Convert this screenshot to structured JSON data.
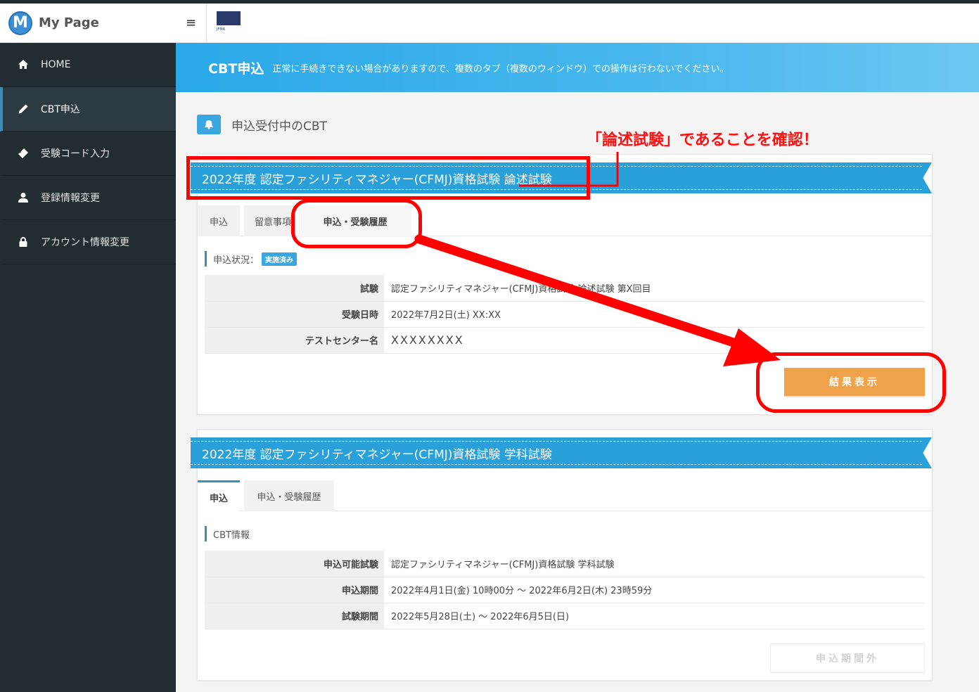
{
  "sidebar": {
    "brand": "My Page",
    "brand_initial": "M",
    "items": [
      {
        "label": "HOME"
      },
      {
        "label": "CBT申込"
      },
      {
        "label": "受験コード入力"
      },
      {
        "label": "登録情報変更"
      },
      {
        "label": "アカウント情報変更"
      }
    ]
  },
  "header": {
    "menu_icon": "≡",
    "org_logo_text": "JFMA"
  },
  "banner": {
    "title": "CBT申込",
    "message": "正常に手続きできない場合がありますので、複数のタブ（複数のウィンドウ）での操作は行わないでください。"
  },
  "section": {
    "title": "申込受付中のCBT"
  },
  "annotation": {
    "text": "「論述試験」であることを確認！"
  },
  "cards": [
    {
      "title": "2022年度 認定ファシリティマネジャー(CFMJ)資格試験 論述試験",
      "tabs": [
        "申込",
        "留意事項",
        "申込・受験履歴"
      ],
      "active_tab": 2,
      "status_label": "申込状況：",
      "status_badge": "実施済み",
      "rows": [
        {
          "key": "試験",
          "value": "認定ファシリティマネジャー(CFMJ)資格試験 論述試験 第X回目"
        },
        {
          "key": "受験日時",
          "value": "2022年7月2日(土)  XX:XX"
        },
        {
          "key": "テストセンター名",
          "value": "XXXXXXXX"
        }
      ],
      "button": "結果表示"
    },
    {
      "title": "2022年度 認定ファシリティマネジャー(CFMJ)資格試験 学科試験",
      "tabs": [
        "申込",
        "申込・受験履歴"
      ],
      "active_tab": 0,
      "status_label": "CBT情報",
      "rows": [
        {
          "key": "申込可能試験",
          "value": "認定ファシリティマネジャー(CFMJ)資格試験 学科試験"
        },
        {
          "key": "申込期間",
          "value": "2022年4月1日(金) 10時00分 ～ 2022年6月2日(木) 23時59分"
        },
        {
          "key": "試験期間",
          "value": "2022年5月28日(土) ～ 2022年6月5日(日)"
        }
      ],
      "button": "申込期間外"
    }
  ],
  "colors": {
    "sidebar_bg": "#222d32",
    "accent_blue": "#2aa0db",
    "button_orange": "#f0a24a",
    "highlight_red": "#ff0000"
  }
}
